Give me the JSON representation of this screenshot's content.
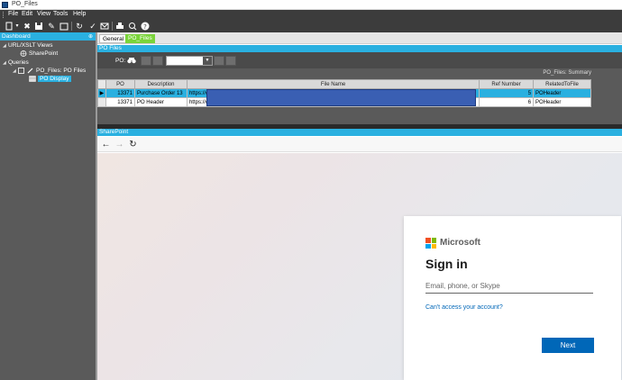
{
  "window": {
    "title": "PO_Files"
  },
  "menu": [
    "File",
    "Edit",
    "View",
    "Tools",
    "Help"
  ],
  "left_panel": {
    "header": "Dashboard",
    "pin": "\u0002",
    "tree": [
      {
        "label": "URL/XSLT Views",
        "level": 0
      },
      {
        "label": "SharePoint",
        "level": 1
      },
      {
        "label": "Queries",
        "level": 0
      },
      {
        "label": "PO_Files: PO Files",
        "level": 1
      },
      {
        "label": "PO Display",
        "level": 2,
        "selected": true
      }
    ]
  },
  "tabs": [
    {
      "label": "General",
      "active": false
    },
    {
      "label": "PO_Files",
      "active": true
    }
  ],
  "po_files": {
    "header": "PO Files",
    "po_label": "PO:",
    "grid_caption": "PO_Files: Summary",
    "columns": [
      "PO",
      "Description",
      "File Name",
      "Ref Number",
      "RelatedToFile"
    ],
    "rows": [
      {
        "po": "13371",
        "description": "Purchase Order 13",
        "file_name": "https://c",
        "ref": "5",
        "related": "POHeader",
        "selected": true
      },
      {
        "po": "13371",
        "description": "PO Header",
        "file_name": "https://c",
        "ref": "6",
        "related": "POHeader",
        "selected": false
      }
    ]
  },
  "sharepoint": {
    "header": "SharePoint",
    "signin": {
      "brand": "Microsoft",
      "title": "Sign in",
      "input_placeholder": "Email, phone, or Skype",
      "cant_access": "Can't access your account?",
      "next": "Next"
    }
  },
  "colors": {
    "accent": "#2ab0e0",
    "tab_active": "#7ad43a",
    "ms_blue": "#0067b8",
    "redaction": "#3a5fb3"
  }
}
